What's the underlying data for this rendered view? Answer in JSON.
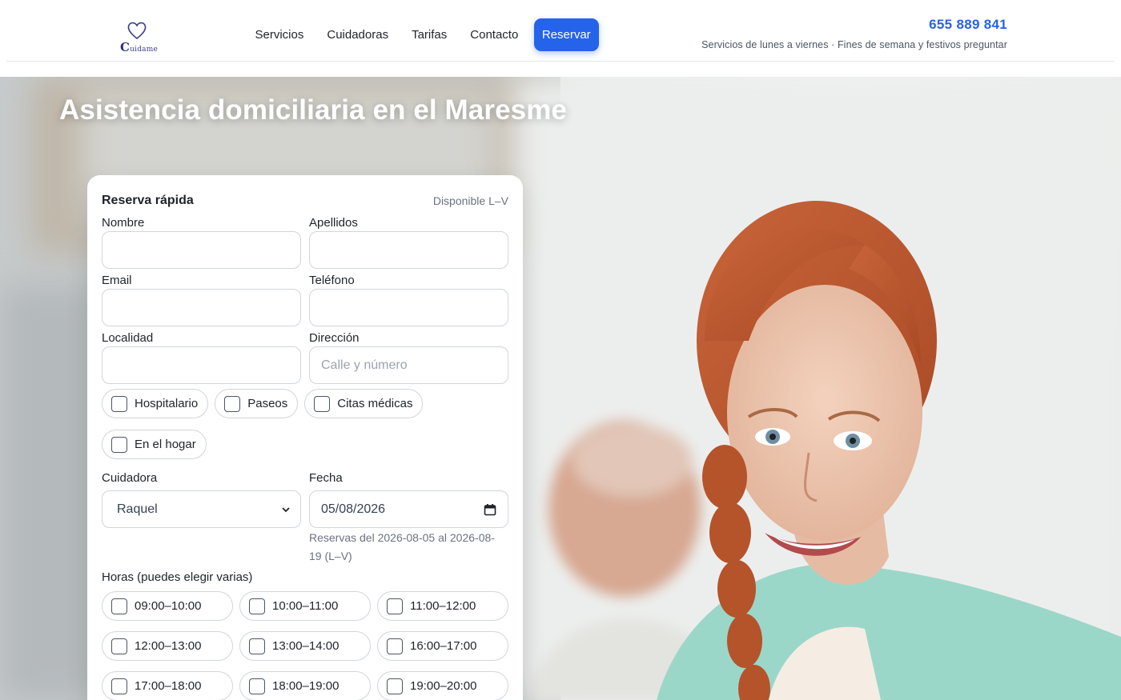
{
  "brand": {
    "logo_text": "Cuídame"
  },
  "nav": {
    "links": [
      "Servicios",
      "Cuidadoras",
      "Tarifas",
      "Contacto"
    ],
    "cta": "Reservar"
  },
  "contact": {
    "phone": "655 889 841",
    "note": "Servicios de lunes a viernes · Fines de semana y festivos preguntar"
  },
  "hero": {
    "title": "Asistencia domiciliaria en el Maresme"
  },
  "form": {
    "title": "Reserva rápida",
    "availability": "Disponible L–V",
    "fields": {
      "nombre": {
        "label": "Nombre",
        "value": "",
        "placeholder": ""
      },
      "apellidos": {
        "label": "Apellidos",
        "value": "",
        "placeholder": ""
      },
      "email": {
        "label": "Email",
        "value": "",
        "placeholder": ""
      },
      "telefono": {
        "label": "Teléfono",
        "value": "",
        "placeholder": ""
      },
      "localidad": {
        "label": "Localidad",
        "value": "",
        "placeholder": ""
      },
      "direccion": {
        "label": "Dirección",
        "value": "",
        "placeholder": "Calle y número"
      }
    },
    "services": [
      "Hospitalario",
      "Paseos",
      "Citas médicas",
      "En el hogar"
    ],
    "caregiver": {
      "label": "Cuidadora",
      "selected": "Raquel"
    },
    "date": {
      "label": "Fecha",
      "value": "05/08/2026",
      "help": "Reservas del 2026-08-05 al 2026-08-19 (L–V)"
    },
    "hours_label": "Horas (puedes elegir varias)",
    "slots": [
      "09:00–10:00",
      "10:00–11:00",
      "11:00–12:00",
      "12:00–13:00",
      "13:00–14:00",
      "16:00–17:00",
      "17:00–18:00",
      "18:00–19:00",
      "19:00–20:00"
    ]
  },
  "colors": {
    "accent": "#2563eb",
    "logo": "#2d2f7a"
  },
  "icons": {
    "select_caret": "chevron-down-icon",
    "date_picker": "calendar-icon",
    "brand": "heart-icon"
  }
}
